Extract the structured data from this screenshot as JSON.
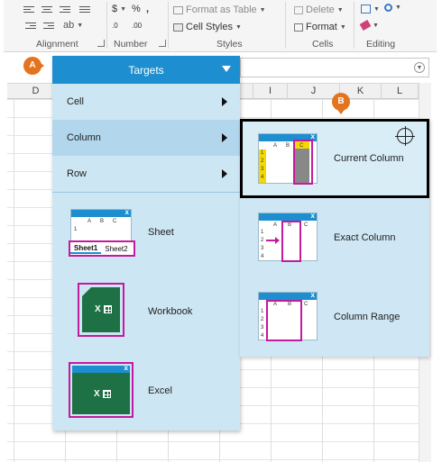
{
  "ribbon": {
    "groups": [
      {
        "label": "Alignment"
      },
      {
        "label": "Number"
      },
      {
        "label": "Styles"
      },
      {
        "label": "Cells"
      },
      {
        "label": "Editing"
      }
    ],
    "buttons": {
      "format_as_table": "Format as Table",
      "cell_styles": "Cell Styles",
      "delete": "Delete",
      "format": "Format",
      "number_dollar": "$",
      "number_percent": "%",
      "number_comma": ",",
      "number_dec": ".00"
    }
  },
  "grid": {
    "columns": [
      "D",
      "",
      "",
      "",
      "",
      "I",
      "J",
      "K",
      "L"
    ]
  },
  "callouts": {
    "a": "A",
    "b": "B"
  },
  "targets_menu": {
    "title": "Targets",
    "items": [
      {
        "label": "Cell",
        "has_submenu": true
      },
      {
        "label": "Column",
        "has_submenu": true,
        "active": true
      },
      {
        "label": "Row",
        "has_submenu": true
      }
    ],
    "big_items": [
      {
        "label": "Sheet",
        "tabs": [
          "Sheet1",
          "Sheet2"
        ]
      },
      {
        "label": "Workbook"
      },
      {
        "label": "Excel"
      }
    ]
  },
  "column_submenu": {
    "items": [
      {
        "label": "Current Column",
        "highlighted": true
      },
      {
        "label": "Exact Column"
      },
      {
        "label": "Column Range"
      }
    ]
  },
  "mini_sheet": {
    "col_headers": [
      "A",
      "B",
      "C"
    ],
    "row_headers": [
      "1",
      "2",
      "3",
      "4"
    ],
    "close": "x"
  },
  "colors": {
    "accent_blue": "#1d8fd0",
    "menu_bg": "#cde6f3",
    "highlight_magenta": "#c41a9e",
    "callout_orange": "#e4731f",
    "excel_green": "#1e7145"
  }
}
